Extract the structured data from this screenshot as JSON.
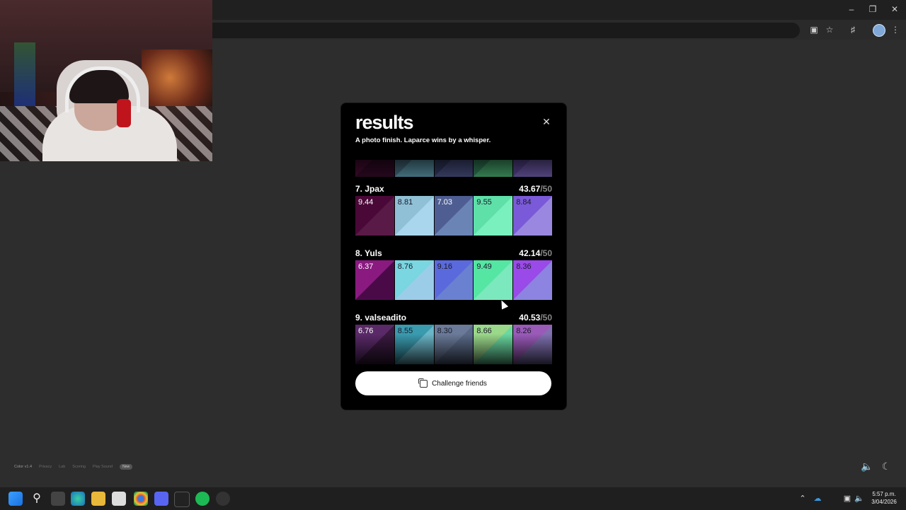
{
  "modal": {
    "title": "results",
    "subtitle": "A photo finish. Laparce wins by a whisper.",
    "close_icon": "close-icon",
    "results": [
      {
        "name": "",
        "score": "",
        "den": "",
        "partial": true,
        "swatches": [
          {
            "value": "",
            "a": "#3a0a2a",
            "b": "#2a0820",
            "dark": false
          },
          {
            "value": "",
            "a": "#3a5a6a",
            "b": "#4a7a8a",
            "dark": false
          },
          {
            "value": "",
            "a": "#2a3050",
            "b": "#3a4068",
            "dark": false
          },
          {
            "value": "",
            "a": "#2a6a4a",
            "b": "#3a8a5a",
            "dark": false
          },
          {
            "value": "",
            "a": "#4a3a7a",
            "b": "#5a4a8a",
            "dark": false
          }
        ]
      },
      {
        "name": "7. Jpax",
        "score": "43.67",
        "den": "/50",
        "swatches": [
          {
            "value": "9.44",
            "a": "#4a0838",
            "b": "#5a1a48",
            "dark": false
          },
          {
            "value": "8.81",
            "a": "#8fc0d6",
            "b": "#a9d6ec",
            "dark": true
          },
          {
            "value": "7.03",
            "a": "#4e5e92",
            "b": "#6a84b6",
            "dark": false
          },
          {
            "value": "9.55",
            "a": "#5ee0a8",
            "b": "#7af0be",
            "dark": true
          },
          {
            "value": "8.84",
            "a": "#7a5ad8",
            "b": "#9a88e0",
            "dark": true
          }
        ]
      },
      {
        "name": "8. Yuls",
        "score": "42.14",
        "den": "/50",
        "swatches": [
          {
            "value": "6.37",
            "a": "#8a1a80",
            "b": "#4a0a48",
            "dark": false
          },
          {
            "value": "8.76",
            "a": "#7ad6e0",
            "b": "#9ccde8",
            "dark": true
          },
          {
            "value": "9.16",
            "a": "#5a6adc",
            "b": "#6a80d0",
            "dark": true
          },
          {
            "value": "9.49",
            "a": "#54e6a2",
            "b": "#7ce8be",
            "dark": true
          },
          {
            "value": "8.36",
            "a": "#9a4ae8",
            "b": "#8c84e0",
            "dark": true
          }
        ]
      },
      {
        "name": "9. valseadito",
        "score": "40.53",
        "den": "/50",
        "swatches": [
          {
            "value": "6.76",
            "a": "#5a2a68",
            "b": "#3a1a40",
            "dark": false
          },
          {
            "value": "8.55",
            "a": "#3a9aae",
            "b": "#6ab6c8",
            "dark": true
          },
          {
            "value": "8.30",
            "a": "#6a7a98",
            "b": "#5a6a88",
            "dark": true
          },
          {
            "value": "8.66",
            "a": "#9ad88a",
            "b": "#6ad8a0",
            "dark": true
          },
          {
            "value": "8.26",
            "a": "#9a5ab8",
            "b": "#8070b0",
            "dark": true
          }
        ]
      }
    ],
    "challenge_label": "Challenge friends",
    "challenge_icon": "copy-icon"
  },
  "footer": {
    "version": "Color v1.4",
    "links": [
      "Privacy",
      "Lab",
      "Scoring",
      "Play Sound"
    ],
    "badge": "New",
    "sound_icon": "speaker-icon",
    "theme_icon": "moon-icon"
  },
  "taskbar": {
    "time": "5:57 p.m.",
    "date": "3/04/2026"
  }
}
